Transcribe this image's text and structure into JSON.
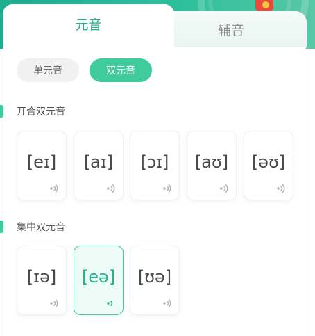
{
  "tabs": {
    "vowels": "元音",
    "consonants": "辅音"
  },
  "filters": {
    "single": "单元音",
    "double": "双元音",
    "selected": "双元音"
  },
  "sections": [
    {
      "title": "开合双元音",
      "cards": [
        {
          "symbol": "[eɪ]",
          "active": false
        },
        {
          "symbol": "[aɪ]",
          "active": false
        },
        {
          "symbol": "[ɔɪ]",
          "active": false
        },
        {
          "symbol": "[aʊ]",
          "active": false
        },
        {
          "symbol": "[əʊ]",
          "active": false
        }
      ]
    },
    {
      "title": "集中双元音",
      "cards": [
        {
          "symbol": "[ɪə]",
          "active": false
        },
        {
          "symbol": "[eə]",
          "active": true
        },
        {
          "symbol": "[ʊə]",
          "active": false
        }
      ]
    }
  ],
  "colors": {
    "accent": "#3fcb9b",
    "accent_text": "#24b38c",
    "speaker": "#b0b4b8"
  },
  "icons": {
    "speaker": "speaker-icon"
  }
}
